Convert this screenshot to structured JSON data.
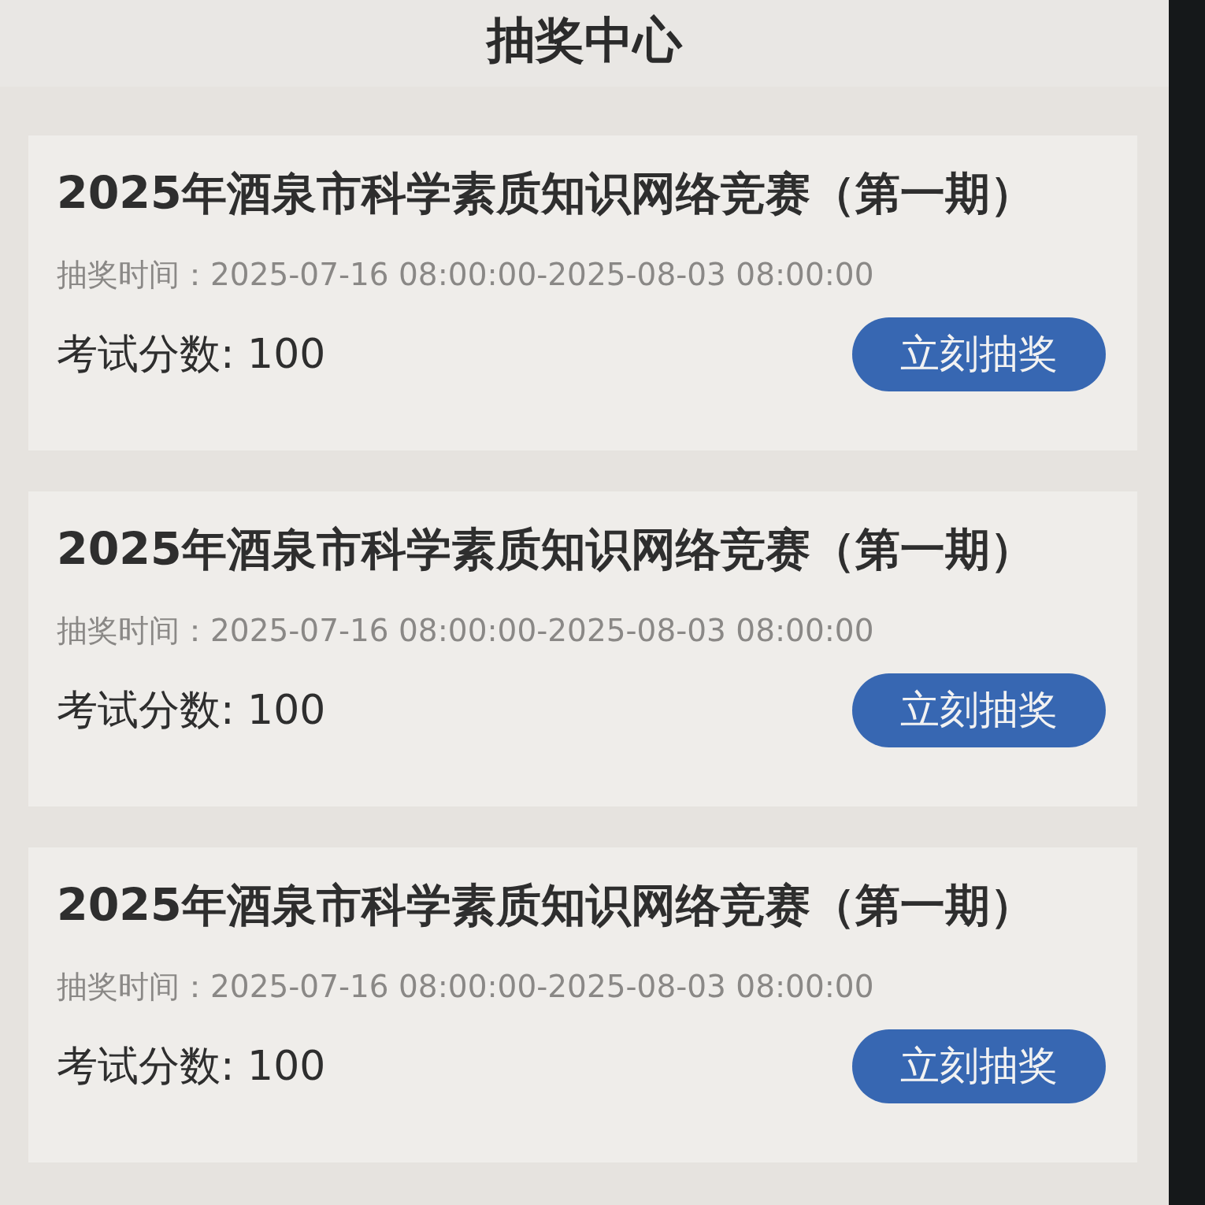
{
  "header": {
    "title": "抽奖中心"
  },
  "events": [
    {
      "title": "2025年酒泉市科学素质知识网络竞赛（第一期）",
      "draw_time": "抽奖时间：2025-07-16 08:00:00-2025-08-03 08:00:00",
      "score": "考试分数: 100",
      "button": "立刻抽奖"
    },
    {
      "title": "2025年酒泉市科学素质知识网络竞赛（第一期）",
      "draw_time": "抽奖时间：2025-07-16 08:00:00-2025-08-03 08:00:00",
      "score": "考试分数: 100",
      "button": "立刻抽奖"
    },
    {
      "title": "2025年酒泉市科学素质知识网络竞赛（第一期）",
      "draw_time": "抽奖时间：2025-07-16 08:00:00-2025-08-03 08:00:00",
      "score": "考试分数: 100",
      "button": "立刻抽奖"
    }
  ]
}
